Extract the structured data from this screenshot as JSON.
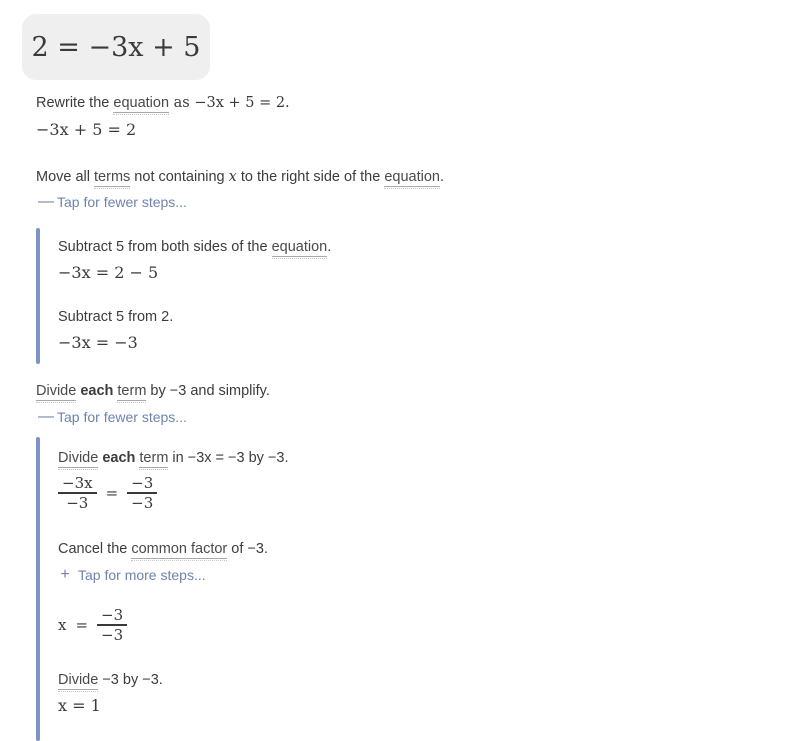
{
  "problem": {
    "expression": "2 = −3x + 5"
  },
  "steps": [
    {
      "id": "rewrite",
      "text_before": "Rewrite the ",
      "term": "equation",
      "text_after": " as −3x + 5 = 2.",
      "result": "−3x + 5 = 2"
    },
    {
      "id": "move-terms",
      "text_a": "Move all ",
      "term_a": "terms",
      "text_b": " not containing ",
      "var": "x",
      "text_c": " to the right side of the ",
      "term_b": "equation",
      "text_d": ".",
      "toggle": {
        "sign": "—",
        "label": "Tap for fewer steps...",
        "state": "expanded"
      },
      "substeps": [
        {
          "text_before": "Subtract 5 from both sides of the ",
          "term": "equation",
          "text_after": ".",
          "result": "−3x = 2 − 5"
        },
        {
          "text_before": "Subtract 5 from 2.",
          "term": "",
          "text_after": "",
          "result": "−3x = −3"
        }
      ]
    },
    {
      "id": "divide",
      "term_a": "Divide",
      "text_a": " each ",
      "term_b": "term",
      "text_b": " by −3 and simplify.",
      "toggle": {
        "sign": "—",
        "label": "Tap for fewer steps...",
        "state": "expanded"
      },
      "substeps": [
        {
          "id": "divide-each-term",
          "term_a": "Divide",
          "text_a": " each ",
          "term_b": "term",
          "text_b": " in −3x = −3 by −3.",
          "fraction_equation": {
            "left": {
              "numerator": "−3x",
              "denominator": "−3"
            },
            "relation": "=",
            "right": {
              "numerator": "−3",
              "denominator": "−3"
            }
          }
        },
        {
          "id": "cancel-common-factor",
          "text_before": "Cancel the ",
          "term": "common factor",
          "text_after": " of −3.",
          "toggle": {
            "sign": "+",
            "label": "Tap for more steps...",
            "state": "collapsed"
          },
          "result_fraction": {
            "lhs": "x",
            "relation": "=",
            "right": {
              "numerator": "−3",
              "denominator": "−3"
            }
          }
        },
        {
          "id": "divide-neg3",
          "term": "Divide",
          "text_after": " −3 by −3.",
          "result": "x = 1"
        }
      ]
    }
  ],
  "colors": {
    "pill_background": "#efefef",
    "link_blue": "#6f83ad",
    "rule_blue": "#8094c4",
    "text": "#3c3c3c"
  }
}
